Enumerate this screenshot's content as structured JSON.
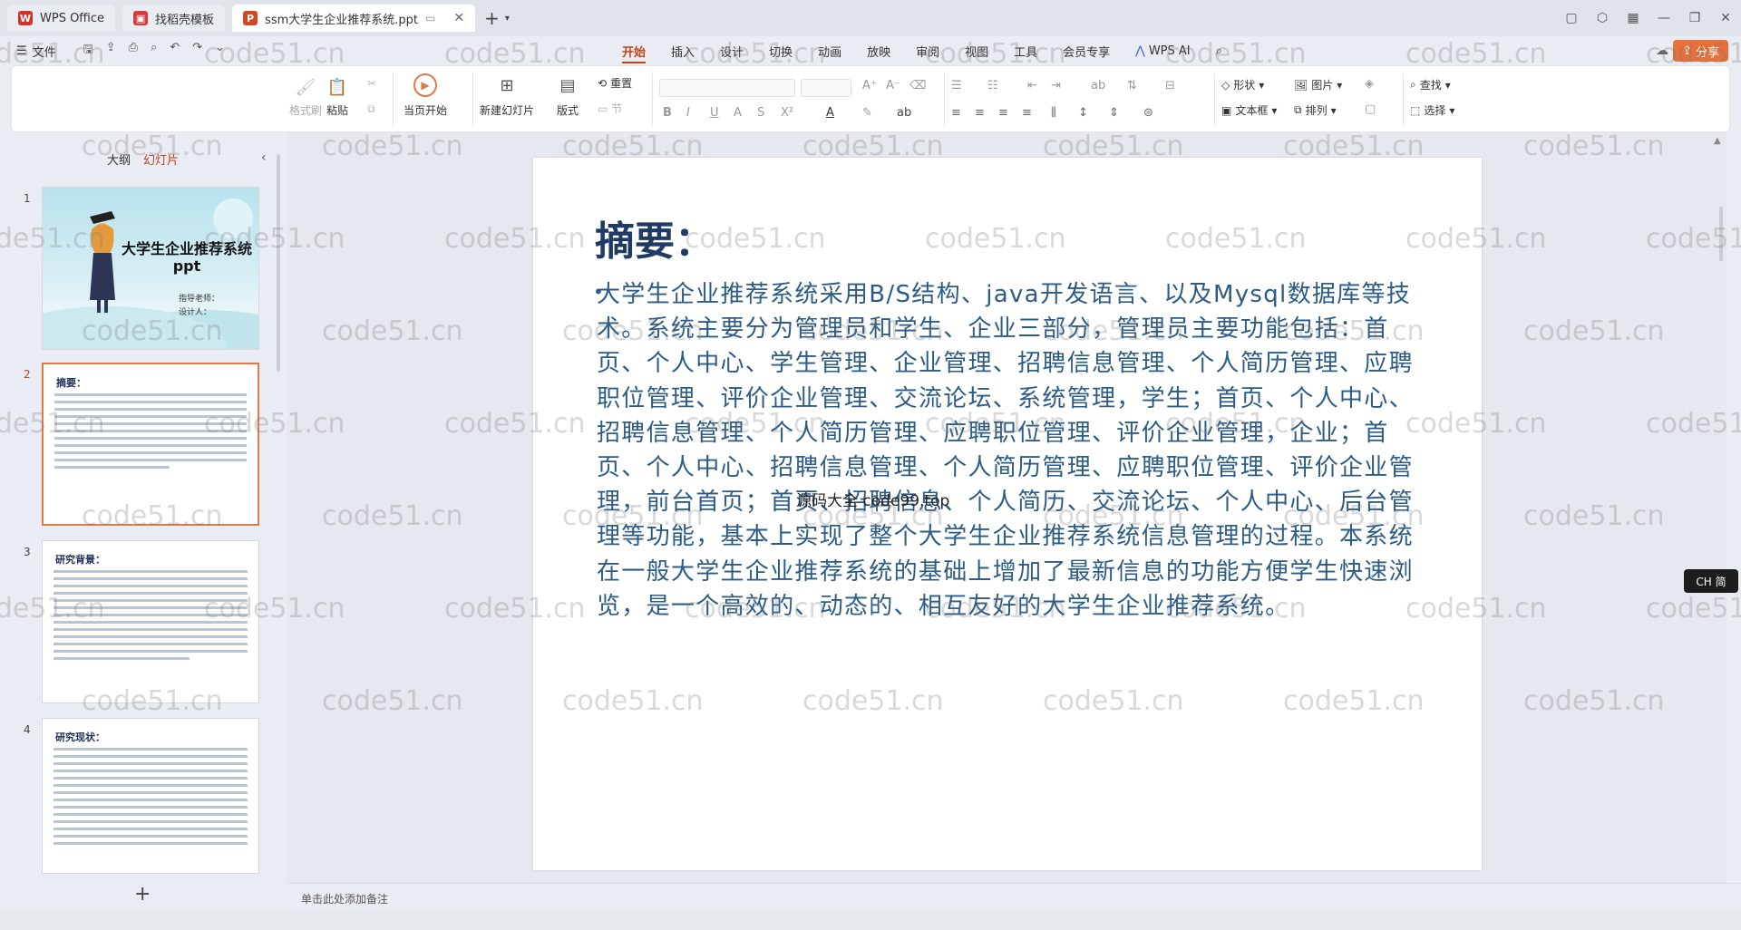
{
  "tabs": [
    {
      "label": "WPS Office",
      "icon": "wps-logo-icon",
      "color": "#d0322a"
    },
    {
      "label": "找稻壳模板",
      "icon": "docer-icon",
      "color": "#d93b3b"
    },
    {
      "label": "ssm大学生企业推荐系统.ppt",
      "icon": "ppt-file-icon",
      "color": "#d24726"
    }
  ],
  "menu": {
    "file": "文件",
    "items": [
      "开始",
      "插入",
      "设计",
      "切换",
      "动画",
      "放映",
      "审阅",
      "视图",
      "工具",
      "会员专享"
    ],
    "active": "开始",
    "wps_ai": "WPS AI",
    "share": "分享"
  },
  "ribbon": {
    "format_painter": "格式刷",
    "paste": "粘贴",
    "start_show": "当页开始",
    "new_slide": "新建幻灯片",
    "layout": "版式",
    "reset": "重置",
    "section": "节",
    "shape": "形状",
    "picture": "图片",
    "find": "查找",
    "textbox": "文本框",
    "arrange": "排列",
    "select": "选择"
  },
  "left_panel": {
    "tabs": [
      "大纲",
      "幻灯片"
    ],
    "active_tab": "幻灯片",
    "slides": [
      {
        "num": "1",
        "title": "大学生企业推荐系统ppt",
        "lines": [
          "指导老师：",
          "设计人："
        ]
      },
      {
        "num": "2",
        "title": "摘要："
      },
      {
        "num": "3",
        "title": "研究背景："
      },
      {
        "num": "4",
        "title": "研究现状："
      }
    ],
    "selected": "2"
  },
  "slide": {
    "title": "摘要：",
    "body": "大学生企业推荐系统采用B/S结构、java开发语言、以及Mysql数据库等技术。系统主要分为管理员和学生、企业三部分，管理员主要功能包括：首页、个人中心、学生管理、企业管理、招聘信息管理、个人简历管理、应聘职位管理、评价企业管理、交流论坛、系统管理，学生；首页、个人中心、招聘信息管理、个人简历管理、应聘职位管理、评价企业管理，企业；首页、个人中心、招聘信息管理、个人简历管理、应聘职位管理、评价企业管理，前台首页；首页、招聘信息、个人简历、交流论坛、个人中心、后台管理等功能，基本上实现了整个大学生企业推荐系统信息管理的过程。本系统在一般大学生企业推荐系统的基础上增加了最新信息的功能方便学生快速浏览，是一个高效的、动态的、相互友好的大学生企业推荐系统。",
    "overlay": "源码大全 code99.top"
  },
  "notes_placeholder": "单击此处添加备注",
  "ime": "CH 简",
  "watermark": "code51.cn",
  "colors": {
    "accent": "#c0451a",
    "share": "#e8703a",
    "slide_text": "#2c5c86"
  }
}
